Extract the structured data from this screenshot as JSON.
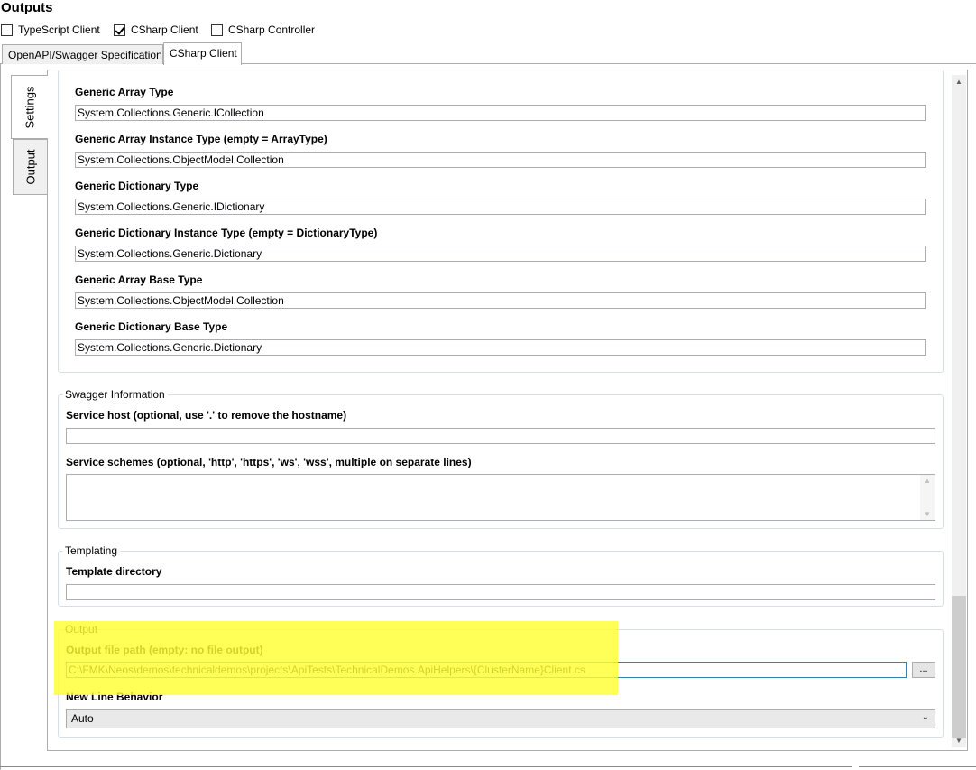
{
  "header": {
    "title": "Outputs"
  },
  "outputs": [
    {
      "label": "TypeScript Client",
      "checked": false
    },
    {
      "label": "CSharp Client",
      "checked": true
    },
    {
      "label": "CSharp Controller",
      "checked": false
    }
  ],
  "tabs": [
    {
      "label": "OpenAPI/Swagger Specification",
      "active": false
    },
    {
      "label": "CSharp Client",
      "active": true
    }
  ],
  "side_tabs": [
    {
      "label": "Settings",
      "active": true
    },
    {
      "label": "Output",
      "active": false
    }
  ],
  "generic_types": {
    "array_type": {
      "label": "Generic Array Type",
      "value": "System.Collections.Generic.ICollection"
    },
    "array_instance_type": {
      "label": "Generic Array Instance Type (empty = ArrayType)",
      "value": "System.Collections.ObjectModel.Collection"
    },
    "dictionary_type": {
      "label": "Generic Dictionary Type",
      "value": "System.Collections.Generic.IDictionary"
    },
    "dictionary_instance_type": {
      "label": "Generic Dictionary Instance Type (empty = DictionaryType)",
      "value": "System.Collections.Generic.Dictionary"
    },
    "array_base_type": {
      "label": "Generic Array Base Type",
      "value": "System.Collections.ObjectModel.Collection"
    },
    "dictionary_base_type": {
      "label": "Generic Dictionary Base Type",
      "value": "System.Collections.Generic.Dictionary"
    }
  },
  "swagger_info": {
    "title": "Swagger Information",
    "service_host": {
      "label": "Service host (optional, use '.' to remove the hostname)",
      "value": ""
    },
    "service_schemes": {
      "label": "Service schemes (optional, 'http', 'https', 'ws', 'wss', multiple on separate lines)",
      "value": ""
    }
  },
  "templating": {
    "title": "Templating",
    "template_directory": {
      "label": "Template directory",
      "value": ""
    }
  },
  "output": {
    "title": "Output",
    "file_path": {
      "label": "Output file path (empty: no file output)",
      "value": "C:\\FMK\\Neos\\demos\\technicaldemos\\projects\\ApiTests\\TechnicalDemos.ApiHelpers\\{ClusterName}Client.cs"
    },
    "browse_label": "...",
    "new_line_behavior": {
      "label": "New Line Behavior",
      "value": "Auto"
    }
  },
  "colors": {
    "highlight": "#ffff33",
    "border": "#acacac"
  },
  "icons": {
    "scroll_up": "▲",
    "scroll_down": "▼",
    "dropdown": "⌄"
  }
}
